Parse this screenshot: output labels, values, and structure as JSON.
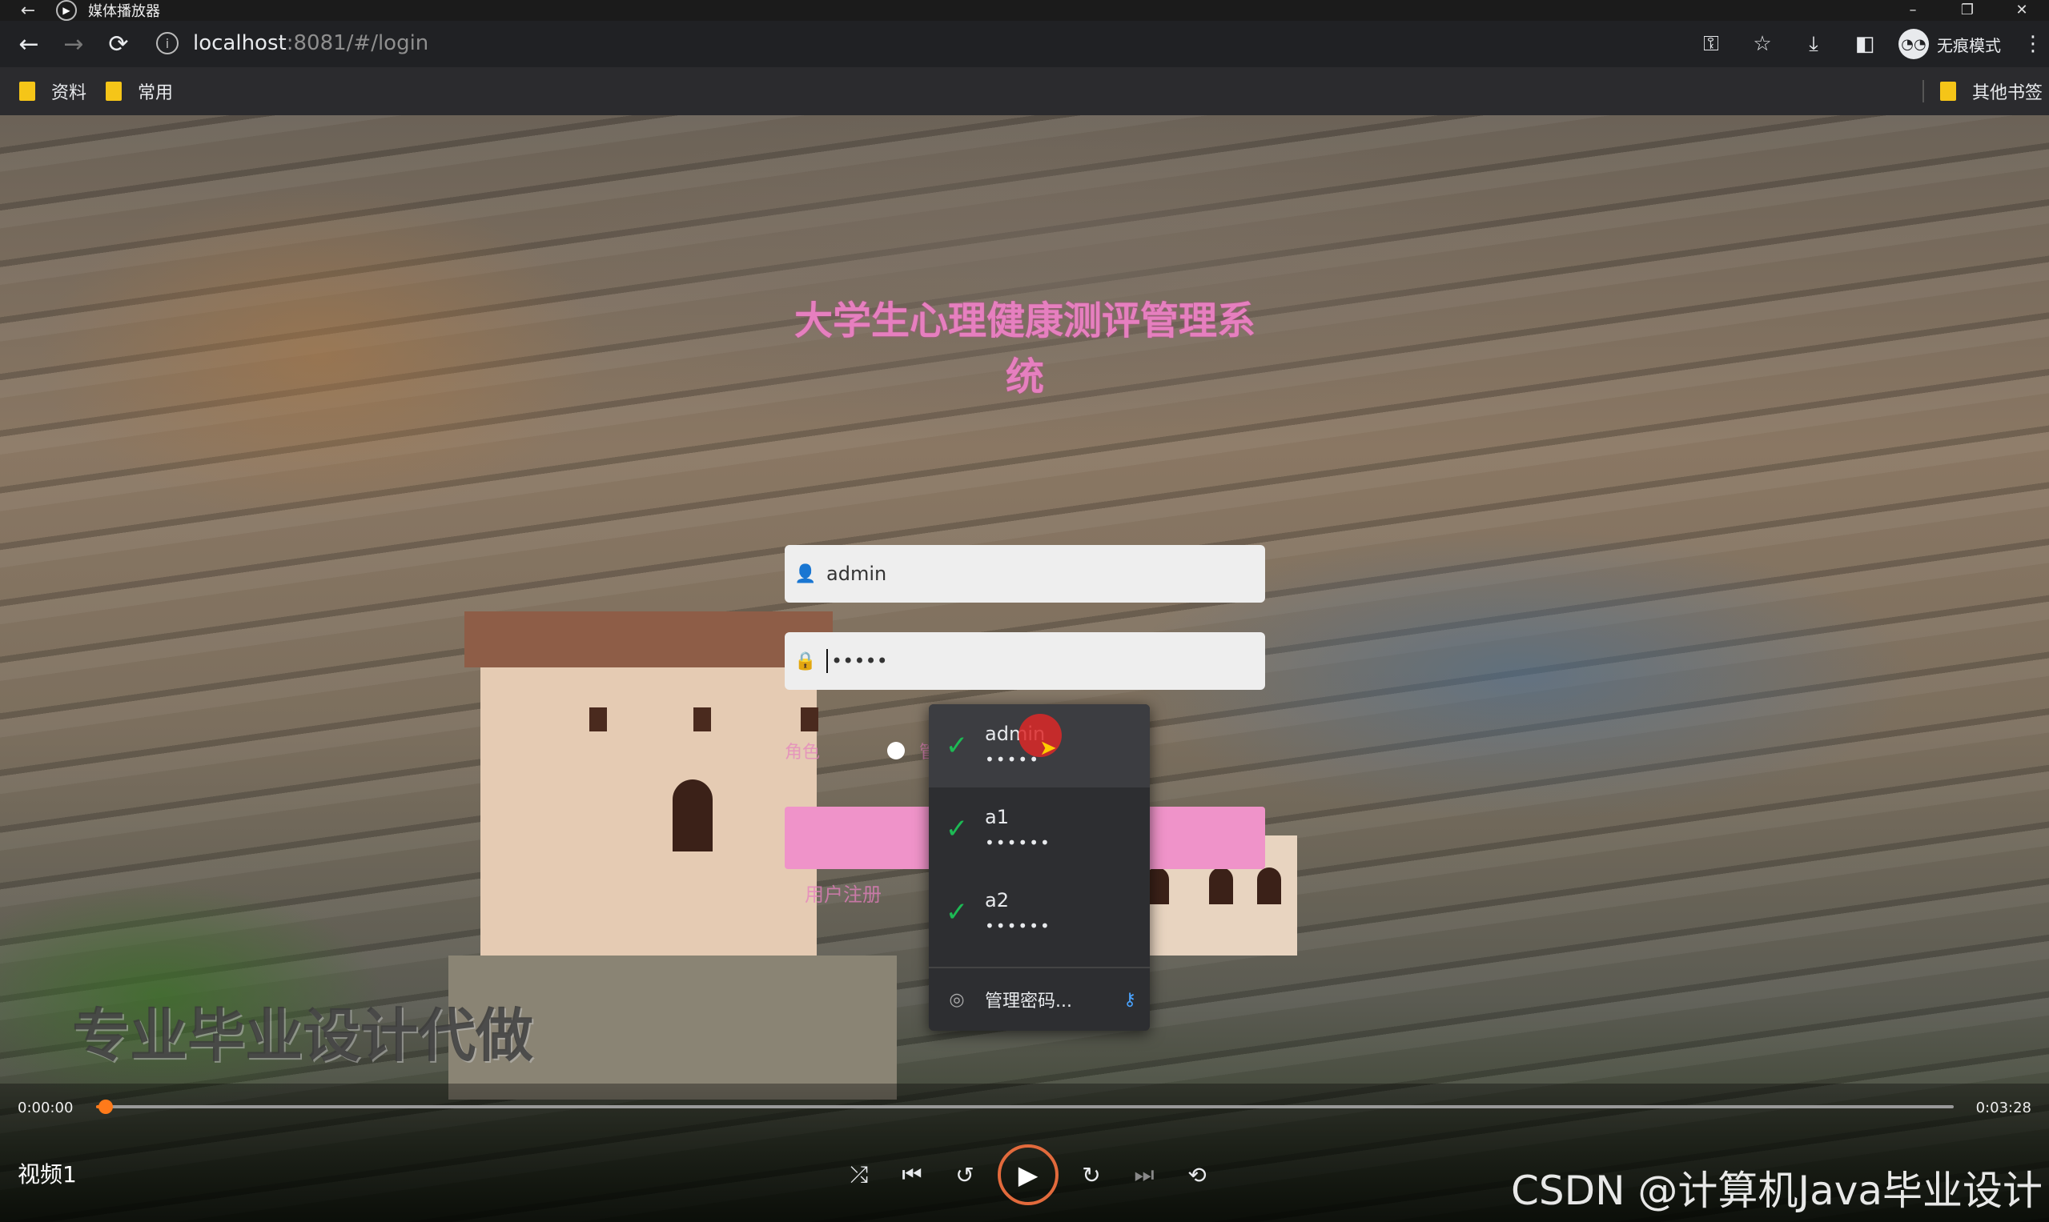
{
  "titlebar": {
    "back": "←",
    "app_title": "媒体播放器",
    "min": "–",
    "restore": "❐",
    "close": "✕"
  },
  "toolbar": {
    "back": "←",
    "forward": "→",
    "reload": "⟳",
    "url_host": "localhost",
    "url_path": ":8081/#/login",
    "incognito_label": "无痕模式"
  },
  "bookmarks": {
    "items": [
      "资料",
      "常用"
    ],
    "other": "其他书签"
  },
  "login": {
    "system_title": "大学生心理健康测评管理系统",
    "username_value": "admin",
    "password_value": "•••••",
    "role_label": "角色",
    "role_option": "管",
    "register_link": "用户注册"
  },
  "autofill": {
    "entries": [
      {
        "user": "admin",
        "mask": "•••••"
      },
      {
        "user": "a1",
        "mask": "••••••"
      },
      {
        "user": "a2",
        "mask": "••••••"
      }
    ],
    "manage_label": "管理密码..."
  },
  "player": {
    "current_time": "0:00:00",
    "duration": "0:03:28",
    "progress": 0.005,
    "video_title": "视频1"
  },
  "watermarks": {
    "promo": "专业毕业设计代做",
    "csdn": "CSDN @计算机Java毕业设计"
  },
  "colors": {
    "accent_pink": "#e67fbf",
    "button_pink": "#ef93c9",
    "seek_orange": "#ff7a1a",
    "check_green": "#1db954"
  }
}
